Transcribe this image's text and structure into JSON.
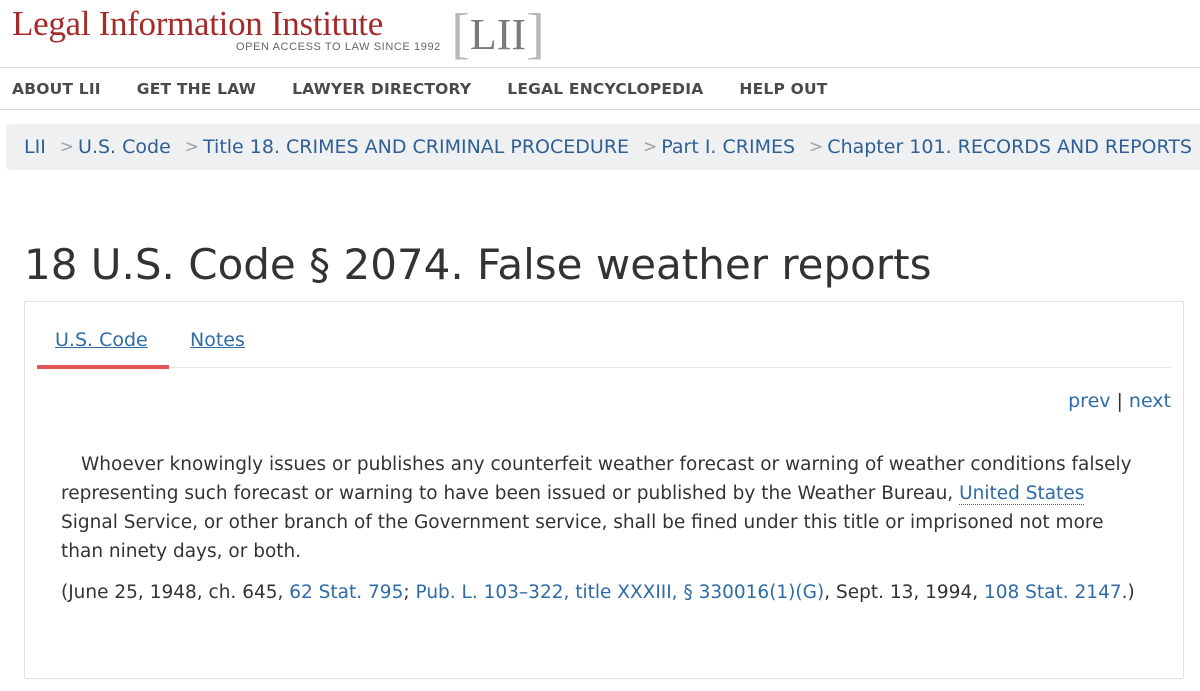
{
  "header": {
    "logo_text": "Legal Information Institute",
    "logo_tagline": "OPEN ACCESS TO LAW SINCE 1992",
    "logo_mark": "LII"
  },
  "nav": {
    "items": [
      {
        "label": "ABOUT LII"
      },
      {
        "label": "GET THE LAW"
      },
      {
        "label": "LAWYER DIRECTORY"
      },
      {
        "label": "LEGAL ENCYCLOPEDIA"
      },
      {
        "label": "HELP OUT"
      }
    ]
  },
  "breadcrumb": {
    "separator": ">",
    "items": [
      {
        "label": "LII"
      },
      {
        "label": "U.S. Code"
      },
      {
        "label": "Title 18. CRIMES AND CRIMINAL PROCEDURE"
      },
      {
        "label": "Part I. CRIMES"
      },
      {
        "label": "Chapter 101. RECORDS AND REPORTS"
      }
    ]
  },
  "page": {
    "title": "18 U.S. Code § 2074. False weather reports"
  },
  "tabs": [
    {
      "label": "U.S. Code",
      "active": true
    },
    {
      "label": "Notes",
      "active": false
    }
  ],
  "pager": {
    "prev_label": "prev",
    "separator": "|",
    "next_label": "next"
  },
  "section": {
    "text_before_link": "Whoever knowingly issues or publishes any counterfeit weather forecast or warning of weather conditions falsely representing such forecast or warning to have been issued or published by the Weather Bureau, ",
    "link_text": "United States",
    "text_after_link": " Signal Service, or other branch of the Government service, shall be fined under this title or imprisoned not more than ninety days, or both."
  },
  "source_credit": {
    "open": "(June 25, 1948, ch. 645, ",
    "link1": "62 Stat. 795",
    "sep1": "; ",
    "link2": "Pub. L. 103–322, title XXXIII, § 330016(1)(G)",
    "sep2": ", Sept. 13, 1994, ",
    "link3": "108 Stat. 2147",
    "close": ".)"
  },
  "colors": {
    "logo_red": "#a52b2b",
    "link_blue": "#2f6ba5",
    "active_tab_bar": "#e05555",
    "breadcrumb_bg": "#eef0f2"
  }
}
